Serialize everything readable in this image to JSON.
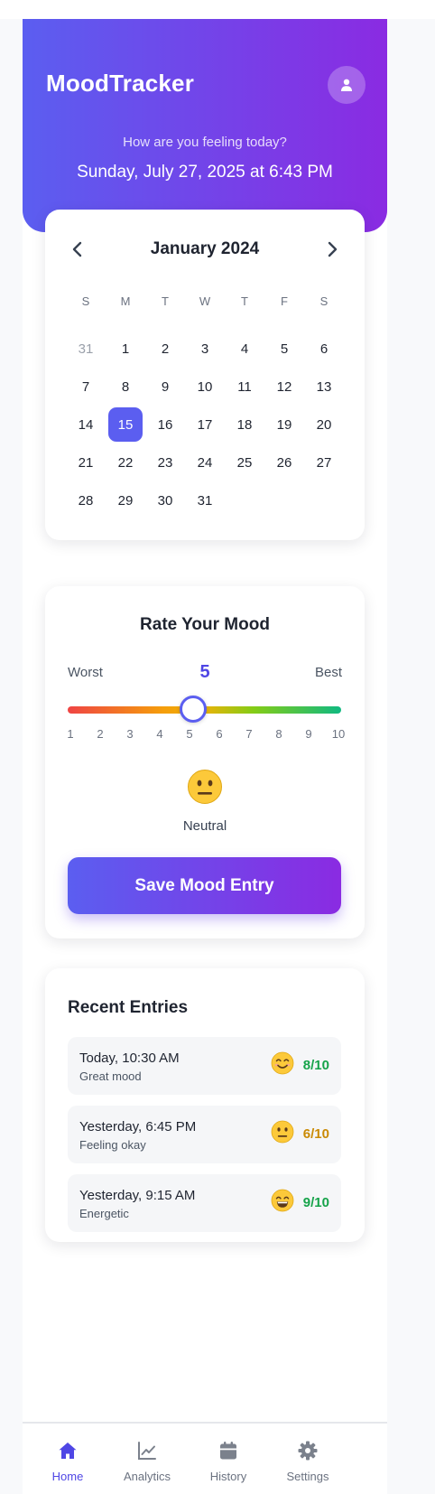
{
  "app": {
    "title": "MoodTracker",
    "greeting": "How are you feeling today?",
    "datetime": "Sunday, July 27, 2025 at 6:43 PM"
  },
  "colors": {
    "brand_start": "#5b5ef0",
    "brand_end": "#8a2be2",
    "accent": "#4f46e5",
    "good": "#16a34a",
    "ok": "#ca8a04"
  },
  "calendar": {
    "month_label": "January 2024",
    "weekdays": [
      "S",
      "M",
      "T",
      "W",
      "T",
      "F",
      "S"
    ],
    "days": [
      "31",
      "1",
      "2",
      "3",
      "4",
      "5",
      "6",
      "7",
      "8",
      "9",
      "10",
      "11",
      "12",
      "13",
      "14",
      "15",
      "16",
      "17",
      "18",
      "19",
      "20",
      "21",
      "22",
      "23",
      "24",
      "25",
      "26",
      "27",
      "28",
      "29",
      "30",
      "31"
    ],
    "selected_day": "15",
    "previous_month_trailing_day": "31"
  },
  "mood": {
    "title": "Rate Your Mood",
    "worst_label": "Worst",
    "best_label": "Best",
    "value": "5",
    "scale_min": 1,
    "scale_max": 10,
    "scale": [
      "1",
      "2",
      "3",
      "4",
      "5",
      "6",
      "7",
      "8",
      "9",
      "10"
    ],
    "face_icon": "neutral-face-emoji",
    "face_label": "Neutral",
    "save_label": "Save Mood Entry"
  },
  "recent": {
    "title": "Recent Entries",
    "entries": [
      {
        "time": "Today, 10:30 AM",
        "note": "Great mood",
        "emoji": "smiling-face-emoji",
        "score": "8/10",
        "tone": "good"
      },
      {
        "time": "Yesterday, 6:45 PM",
        "note": "Feeling okay",
        "emoji": "neutral-face-emoji",
        "score": "6/10",
        "tone": "ok"
      },
      {
        "time": "Yesterday, 9:15 AM",
        "note": "Energetic",
        "emoji": "grinning-face-emoji",
        "score": "9/10",
        "tone": "good"
      }
    ]
  },
  "nav": {
    "items": [
      {
        "label": "Home",
        "icon": "home-icon",
        "active": true
      },
      {
        "label": "Analytics",
        "icon": "chart-line-icon",
        "active": false
      },
      {
        "label": "History",
        "icon": "calendar-icon",
        "active": false
      },
      {
        "label": "Settings",
        "icon": "gear-icon",
        "active": false
      }
    ]
  }
}
